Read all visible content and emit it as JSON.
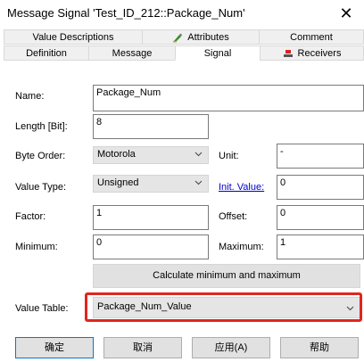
{
  "window": {
    "title": "Message Signal 'Test_ID_212::Package_Num'",
    "close_glyph": "✕"
  },
  "tabs": {
    "row1": [
      {
        "label": "Value Descriptions"
      },
      {
        "label": "Attributes",
        "icon": "attributes-icon"
      },
      {
        "label": "Comment"
      }
    ],
    "row2": [
      {
        "label": "Definition"
      },
      {
        "label": "Message"
      },
      {
        "label": "Signal",
        "active": true
      },
      {
        "label": "Receivers",
        "icon": "receivers-icon"
      }
    ]
  },
  "form": {
    "name_label": "Name:",
    "name_value": "Package_Num",
    "length_label": "Length [Bit]:",
    "length_value": "8",
    "byte_order_label": "Byte Order:",
    "byte_order_value": "Motorola",
    "unit_label": "Unit:",
    "unit_value": "-",
    "value_type_label": "Value Type:",
    "value_type_value": "Unsigned",
    "init_value_label": "Init. Value:",
    "init_value_value": "0",
    "factor_label": "Factor:",
    "factor_value": "1",
    "offset_label": "Offset:",
    "offset_value": "0",
    "minimum_label": "Minimum:",
    "minimum_value": "0",
    "maximum_label": "Maximum:",
    "maximum_value": "1",
    "calc_button_label": "Calculate minimum and maximum",
    "value_table_label": "Value Table:",
    "value_table_value": "Package_Num_Value"
  },
  "footer": {
    "ok": "确定",
    "cancel": "取消",
    "apply": "应用(A)",
    "help": "帮助"
  },
  "colors": {
    "highlight": "#e0261e",
    "link": "#0000cc",
    "default_button_border": "#0078d7"
  }
}
